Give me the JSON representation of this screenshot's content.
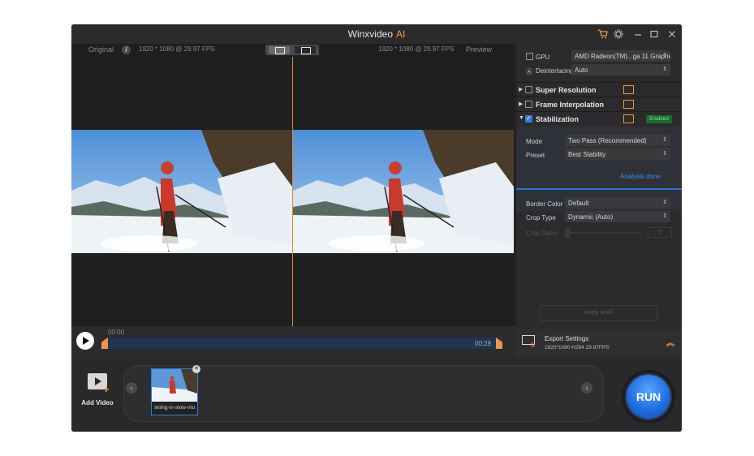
{
  "window": {
    "title": "Winxvideo",
    "title_accent": "AI",
    "accent_color": "#f29a3a",
    "icons": [
      "cart-icon",
      "settings-icon",
      "minimize-icon",
      "maximize-icon",
      "close-icon"
    ]
  },
  "preview_header": {
    "original_label": "Original",
    "original_info": "1920 * 1080 @ 29.97 FPS",
    "preview_info": "1920 * 1080 @ 29.97 FPS",
    "preview_label": "Preview"
  },
  "timeline": {
    "start_time": "00:00",
    "end_time": "00:29"
  },
  "panel": {
    "gpu_label": "GPU",
    "gpu_value": "AMD Radeon(TM)...ga 11 Graphics",
    "deinterlacing_label": "Deinterlacing",
    "deinterlacing_value": "Auto",
    "super_resolution": {
      "label": "Super Resolution",
      "checked": false
    },
    "frame_interpolation": {
      "label": "Frame Interpolation",
      "checked": false
    },
    "stabilization": {
      "label": "Stabilization",
      "checked": true,
      "badge": "Enabled"
    },
    "mode_label": "Mode",
    "mode_value": "Two Pass (Recommended)",
    "preset_label": "Preset",
    "preset_value": "Best Stability",
    "analysis_status": "Analysis done",
    "border_color_label": "Border Color",
    "border_color_value": "Default",
    "crop_type_label": "Crop Type",
    "crop_type_value": "Dynamic (Auto)",
    "crop_ratio_label": "Crop Ratio",
    "crop_ratio_value": "0",
    "apply_all_label": "Apply to All"
  },
  "export": {
    "title": "Export Settings",
    "details": "1920*1080   H264   29.97FPS"
  },
  "bottom": {
    "add_video_label": "Add Video",
    "thumbnail_name": "skiing-in-slow-mo",
    "run_label": "RUN"
  }
}
